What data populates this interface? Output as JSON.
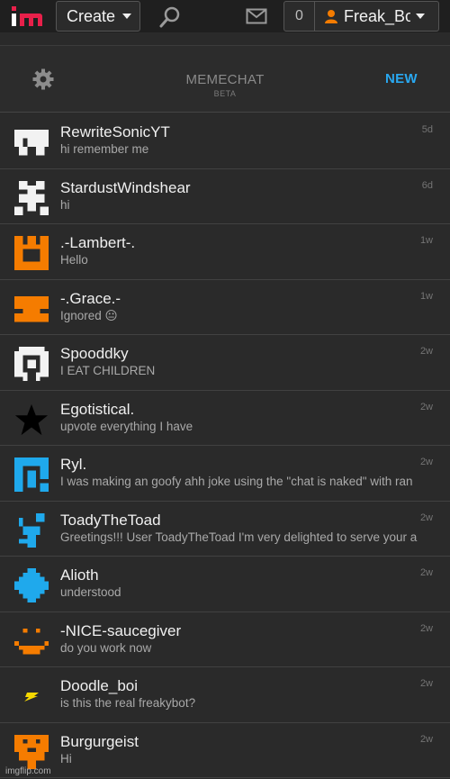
{
  "topbar": {
    "create_label": "Create",
    "notification_count": "0",
    "username": "Freak_Bo"
  },
  "chat": {
    "title": "MEMECHAT",
    "subtitle": "BETA",
    "new_label": "NEW"
  },
  "colors": {
    "accent_blue": "#29a8f0",
    "accent_orange": "#f57c00",
    "logo_red": "#e8204a"
  },
  "conversations": [
    {
      "name": "RewriteSonicYT",
      "message": "hi remember me",
      "time": "5d",
      "avatar": "white-pixel-avatar"
    },
    {
      "name": "StardustWindshear",
      "message": "hi",
      "time": "6d",
      "avatar": "white-pixel-avatar"
    },
    {
      "name": ".-Lambert-.",
      "message": "Hello",
      "time": "1w",
      "avatar": "orange-pixel-avatar"
    },
    {
      "name": "-.Grace.-",
      "message": "Ignored 😐",
      "time": "1w",
      "avatar": "orange-pixel-avatar"
    },
    {
      "name": "Spooddky",
      "message": "I EAT CHILDREN",
      "time": "2w",
      "avatar": "white-pixel-avatar"
    },
    {
      "name": "Egotistical.",
      "message": "upvote everything I have",
      "time": "2w",
      "avatar": "black-star-avatar"
    },
    {
      "name": "Ryl.",
      "message": "I was making an goofy ahh joke using the \"chat is naked\" with ran",
      "time": "2w",
      "avatar": "blue-pixel-avatar"
    },
    {
      "name": "ToadyTheToad",
      "message": "Greetings!!! User ToadyTheToad I'm very delighted to serve your a",
      "time": "2w",
      "avatar": "blue-pixel-avatar"
    },
    {
      "name": "Alioth",
      "message": "understood",
      "time": "2w",
      "avatar": "blue-pixel-avatar"
    },
    {
      "name": "-NICE-saucegiver",
      "message": "do you work now",
      "time": "2w",
      "avatar": "orange-pixel-avatar"
    },
    {
      "name": "Doodle_boi",
      "message": "is this the real freakybot?",
      "time": "2w",
      "avatar": "lightning-icon"
    },
    {
      "name": "Burgurgeist",
      "message": "Hi",
      "time": "2w",
      "avatar": "orange-pixel-avatar"
    }
  ],
  "watermark": "imgflip.com"
}
